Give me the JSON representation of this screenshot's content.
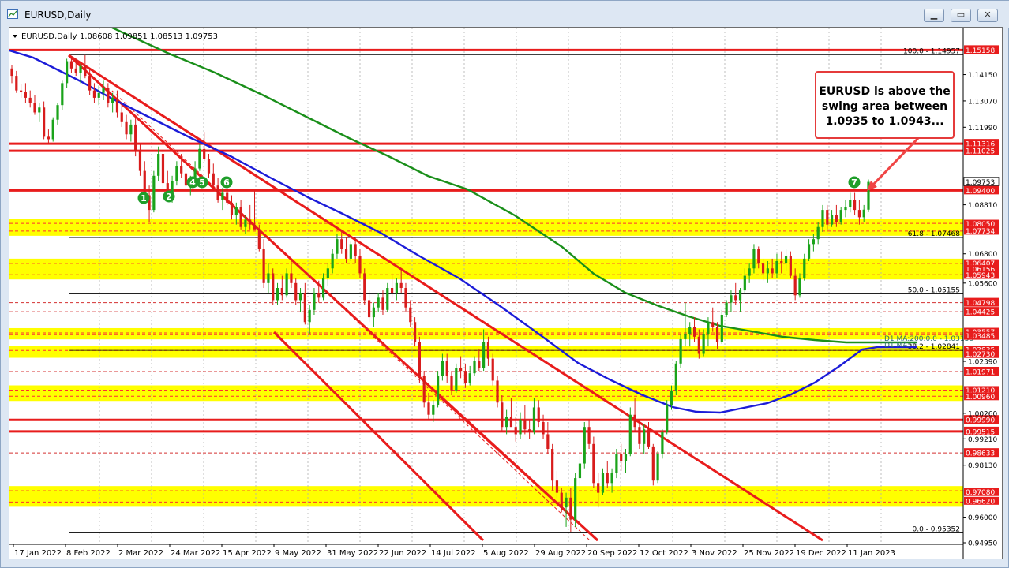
{
  "window": {
    "title": "EURUSD,Daily",
    "buttons": [
      "▁",
      "▭",
      "✕"
    ]
  },
  "colors": {
    "red": "#e81c1c",
    "yellow": "#ffff00",
    "blue": "#1c1cd8",
    "green": "#1a8f1a",
    "bull": "#1aa31a",
    "bear": "#d81c1c",
    "tag_green": "#1f9e2a"
  },
  "chart_data": {
    "type": "candlestick",
    "symbol_line": {
      "symbol": "EURUSD,Daily",
      "ohlc": "1.08608 1.09851 1.08513 1.09753"
    },
    "ylim": [
      0.9495,
      1.153
    ],
    "price_ticks": [
      1.1415,
      1.1307,
      1.1199,
      1.0881,
      1.068,
      1.056,
      1.0239,
      1.0026,
      0.9921,
      0.9813,
      0.96,
      0.9495
    ],
    "x_ticks": [
      "17 Jan 2022",
      "8 Feb 2022",
      "2 Mar 2022",
      "24 Mar 2022",
      "15 Apr 2022",
      "9 May 2022",
      "31 May 2022",
      "22 Jun 2022",
      "14 Jul 2022",
      "5 Aug 2022",
      "29 Aug 2022",
      "20 Sep 2022",
      "12 Oct 2022",
      "3 Nov 2022",
      "25 Nov 2022",
      "19 Dec 2022",
      "11 Jan 2023"
    ],
    "x_range_days": [
      0,
      370
    ],
    "current_price": "1.09753",
    "red_levels": [
      {
        "price": 1.15158,
        "label": "1.15158"
      },
      {
        "price": 1.11316,
        "label": "1.11316"
      },
      {
        "price": 1.11025,
        "label": "1.11025"
      },
      {
        "price": 1.094,
        "label": "1.09400"
      },
      {
        "price": 0.9999,
        "label": "0.99990"
      },
      {
        "price": 0.99515,
        "label": "0.99515"
      }
    ],
    "dashed_levels": [
      {
        "price": 1.04798,
        "label": "1.04798"
      },
      {
        "price": 1.04425,
        "label": "1.04425"
      },
      {
        "price": 1.01971,
        "label": "1.01971"
      },
      {
        "price": 0.98633,
        "label": "0.98633"
      }
    ],
    "yellow_zones": [
      {
        "top": 1.0805,
        "bottom": 1.07734,
        "labels": [
          "1.08050",
          "1.07734"
        ]
      },
      {
        "top": 1.06407,
        "bottom": 1.05943,
        "labels": [
          "1.06407",
          "1.06156",
          "1.05943"
        ]
      },
      {
        "top": 1.03557,
        "bottom": 1.03485,
        "labels": [
          "1.03557",
          "1.03485"
        ]
      },
      {
        "top": 1.02835,
        "bottom": 1.0273,
        "labels": [
          "1.02835",
          "1.02730"
        ]
      },
      {
        "top": 1.0121,
        "bottom": 1.0096,
        "labels": [
          "1.01210",
          "1.00960"
        ]
      },
      {
        "top": 0.9708,
        "bottom": 0.9662,
        "labels": [
          "0.97080",
          "0.96620"
        ]
      }
    ],
    "fibonacci": [
      {
        "price": 1.14957,
        "label": "100.0 - 1.14957"
      },
      {
        "price": 1.07468,
        "label": "61.8 - 1.07468"
      },
      {
        "price": 1.05155,
        "label": "50.0 - 1.05155"
      },
      {
        "price": 1.02841,
        "label": "38.2 - 1.02841"
      },
      {
        "price": 0.95352,
        "label": "0.0 - 0.95352"
      }
    ],
    "ma_labels": [
      "D1 MA:200:0.0 - 1.03138",
      "D1 MA:"
    ],
    "swing_markers": [
      "1",
      "2",
      "4",
      "5",
      "6",
      "7"
    ],
    "candles": [
      [
        1.144,
        1.1455,
        1.138,
        1.141
      ],
      [
        1.141,
        1.143,
        1.134,
        1.135
      ],
      [
        1.135,
        1.1375,
        1.132,
        1.1345
      ],
      [
        1.1345,
        1.138,
        1.13,
        1.132
      ],
      [
        1.132,
        1.135,
        1.128,
        1.13
      ],
      [
        1.13,
        1.133,
        1.125,
        1.126
      ],
      [
        1.126,
        1.13,
        1.122,
        1.128
      ],
      [
        1.128,
        1.1305,
        1.115,
        1.116
      ],
      [
        1.116,
        1.119,
        1.113,
        1.115
      ],
      [
        1.115,
        1.124,
        1.114,
        1.123
      ],
      [
        1.123,
        1.13,
        1.121,
        1.129
      ],
      [
        1.129,
        1.139,
        1.127,
        1.138
      ],
      [
        1.138,
        1.148,
        1.136,
        1.147
      ],
      [
        1.147,
        1.149,
        1.142,
        1.144
      ],
      [
        1.144,
        1.148,
        1.141,
        1.142
      ],
      [
        1.142,
        1.146,
        1.138,
        1.145
      ],
      [
        1.145,
        1.1495,
        1.14,
        1.141
      ],
      [
        1.141,
        1.144,
        1.133,
        1.135
      ],
      [
        1.135,
        1.138,
        1.13,
        1.132
      ],
      [
        1.132,
        1.137,
        1.129,
        1.134
      ],
      [
        1.134,
        1.139,
        1.131,
        1.136
      ],
      [
        1.136,
        1.138,
        1.128,
        1.13
      ],
      [
        1.13,
        1.134,
        1.126,
        1.132
      ],
      [
        1.132,
        1.135,
        1.124,
        1.126
      ],
      [
        1.126,
        1.13,
        1.12,
        1.122
      ],
      [
        1.122,
        1.125,
        1.115,
        1.117
      ],
      [
        1.117,
        1.123,
        1.114,
        1.121
      ],
      [
        1.121,
        1.124,
        1.108,
        1.11
      ],
      [
        1.11,
        1.113,
        1.1,
        1.102
      ],
      [
        1.102,
        1.106,
        1.09,
        1.092
      ],
      [
        1.092,
        1.096,
        1.081,
        1.086
      ],
      [
        1.086,
        1.102,
        1.085,
        1.1
      ],
      [
        1.1,
        1.112,
        1.098,
        1.109
      ],
      [
        1.109,
        1.11,
        1.095,
        1.097
      ],
      [
        1.097,
        1.102,
        1.09,
        1.091
      ],
      [
        1.091,
        1.1,
        1.089,
        1.098
      ],
      [
        1.098,
        1.106,
        1.096,
        1.104
      ],
      [
        1.104,
        1.109,
        1.099,
        1.101
      ],
      [
        1.101,
        1.104,
        1.094,
        1.096
      ],
      [
        1.096,
        1.1,
        1.092,
        1.098
      ],
      [
        1.098,
        1.106,
        1.097,
        1.103
      ],
      [
        1.103,
        1.113,
        1.102,
        1.111
      ],
      [
        1.111,
        1.118,
        1.106,
        1.107
      ],
      [
        1.107,
        1.109,
        1.099,
        1.101
      ],
      [
        1.101,
        1.105,
        1.094,
        1.096
      ],
      [
        1.096,
        1.099,
        1.089,
        1.09
      ],
      [
        1.09,
        1.095,
        1.086,
        1.093
      ],
      [
        1.093,
        1.096,
        1.088,
        1.089
      ],
      [
        1.089,
        1.092,
        1.082,
        1.084
      ],
      [
        1.084,
        1.089,
        1.08,
        1.087
      ],
      [
        1.087,
        1.09,
        1.078,
        1.079
      ],
      [
        1.079,
        1.084,
        1.076,
        1.082
      ],
      [
        1.082,
        1.088,
        1.078,
        1.08
      ],
      [
        1.08,
        1.094,
        1.079,
        1.078
      ],
      [
        1.078,
        1.08,
        1.069,
        1.07
      ],
      [
        1.07,
        1.074,
        1.054,
        1.056
      ],
      [
        1.056,
        1.064,
        1.052,
        1.06
      ],
      [
        1.06,
        1.062,
        1.047,
        1.049
      ],
      [
        1.049,
        1.056,
        1.047,
        1.054
      ],
      [
        1.054,
        1.059,
        1.049,
        1.051
      ],
      [
        1.051,
        1.062,
        1.05,
        1.06
      ],
      [
        1.06,
        1.065,
        1.054,
        1.056
      ],
      [
        1.056,
        1.058,
        1.047,
        1.049
      ],
      [
        1.049,
        1.054,
        1.044,
        1.052
      ],
      [
        1.052,
        1.056,
        1.039,
        1.04
      ],
      [
        1.04,
        1.047,
        1.035,
        1.045
      ],
      [
        1.045,
        1.054,
        1.043,
        1.052
      ],
      [
        1.052,
        1.057,
        1.048,
        1.05
      ],
      [
        1.05,
        1.06,
        1.049,
        1.058
      ],
      [
        1.058,
        1.064,
        1.055,
        1.062
      ],
      [
        1.062,
        1.07,
        1.06,
        1.068
      ],
      [
        1.068,
        1.076,
        1.066,
        1.074
      ],
      [
        1.074,
        1.077,
        1.068,
        1.07
      ],
      [
        1.07,
        1.075,
        1.064,
        1.066
      ],
      [
        1.066,
        1.073,
        1.065,
        1.072
      ],
      [
        1.072,
        1.075,
        1.064,
        1.067
      ],
      [
        1.067,
        1.07,
        1.058,
        1.06
      ],
      [
        1.06,
        1.062,
        1.047,
        1.049
      ],
      [
        1.049,
        1.053,
        1.04,
        1.042
      ],
      [
        1.042,
        1.048,
        1.038,
        1.046
      ],
      [
        1.046,
        1.052,
        1.044,
        1.05
      ],
      [
        1.05,
        1.053,
        1.043,
        1.045
      ],
      [
        1.045,
        1.056,
        1.044,
        1.054
      ],
      [
        1.054,
        1.06,
        1.05,
        1.052
      ],
      [
        1.052,
        1.058,
        1.049,
        1.056
      ],
      [
        1.056,
        1.061,
        1.052,
        1.054
      ],
      [
        1.054,
        1.056,
        1.044,
        1.046
      ],
      [
        1.046,
        1.049,
        1.038,
        1.04
      ],
      [
        1.04,
        1.042,
        1.03,
        1.032
      ],
      [
        1.032,
        1.034,
        1.015,
        1.018
      ],
      [
        1.018,
        1.02,
        1.005,
        1.007
      ],
      [
        1.007,
        1.011,
        1.0,
        1.002
      ],
      [
        1.002,
        1.008,
        0.999,
        1.006
      ],
      [
        1.006,
        1.02,
        1.005,
        1.018
      ],
      [
        1.018,
        1.027,
        1.016,
        1.024
      ],
      [
        1.024,
        1.027,
        1.015,
        1.018
      ],
      [
        1.018,
        1.02,
        1.01,
        1.012
      ],
      [
        1.012,
        1.023,
        1.011,
        1.021
      ],
      [
        1.021,
        1.026,
        1.017,
        1.02
      ],
      [
        1.02,
        1.023,
        1.013,
        1.015
      ],
      [
        1.015,
        1.022,
        1.014,
        1.019
      ],
      [
        1.019,
        1.026,
        1.018,
        1.024
      ],
      [
        1.024,
        1.029,
        1.02,
        1.021
      ],
      [
        1.021,
        1.037,
        1.02,
        1.032
      ],
      [
        1.032,
        1.034,
        1.022,
        1.025
      ],
      [
        1.025,
        1.027,
        1.014,
        1.016
      ],
      [
        1.016,
        1.018,
        1.005,
        1.007
      ],
      [
        1.007,
        1.01,
        0.995,
        0.997
      ],
      [
        0.997,
        1.004,
        0.994,
        1.001
      ],
      [
        1.001,
        1.009,
        0.999,
        0.997
      ],
      [
        0.997,
        1.001,
        0.991,
        0.994
      ],
      [
        0.994,
        1.003,
        0.992,
        1.0
      ],
      [
        1.0,
        1.006,
        0.994,
        0.996
      ],
      [
        0.996,
        1.0,
        0.992,
        0.995
      ],
      [
        0.995,
        1.009,
        0.994,
        1.005
      ],
      [
        1.005,
        1.008,
        0.997,
        0.999
      ],
      [
        0.999,
        1.002,
        0.992,
        0.994
      ],
      [
        0.994,
        0.999,
        0.986,
        0.988
      ],
      [
        0.988,
        0.99,
        0.971,
        0.975
      ],
      [
        0.975,
        0.979,
        0.968,
        0.97
      ],
      [
        0.97,
        0.972,
        0.962,
        0.964
      ],
      [
        0.964,
        0.97,
        0.956,
        0.968
      ],
      [
        0.968,
        0.972,
        0.954,
        0.959
      ],
      [
        0.959,
        0.978,
        0.956,
        0.976
      ],
      [
        0.976,
        0.985,
        0.973,
        0.982
      ],
      [
        0.982,
        0.999,
        0.98,
        0.997
      ],
      [
        0.997,
        1.0,
        0.988,
        0.99
      ],
      [
        0.99,
        0.993,
        0.972,
        0.974
      ],
      [
        0.974,
        0.978,
        0.964,
        0.97
      ],
      [
        0.97,
        0.98,
        0.969,
        0.978
      ],
      [
        0.978,
        0.983,
        0.972,
        0.974
      ],
      [
        0.974,
        0.98,
        0.97,
        0.978
      ],
      [
        0.978,
        0.988,
        0.976,
        0.986
      ],
      [
        0.986,
        0.99,
        0.979,
        0.983
      ],
      [
        0.983,
        0.988,
        0.978,
        0.986
      ],
      [
        0.986,
        1.005,
        0.985,
        1.002
      ],
      [
        1.002,
        1.009,
        0.995,
        0.997
      ],
      [
        0.997,
        0.999,
        0.988,
        0.99
      ],
      [
        0.99,
        0.998,
        0.986,
        0.996
      ],
      [
        0.996,
        0.999,
        0.988,
        0.989
      ],
      [
        0.989,
        0.99,
        0.973,
        0.975
      ],
      [
        0.975,
        0.987,
        0.974,
        0.986
      ],
      [
        0.986,
        0.996,
        0.984,
        0.995
      ],
      [
        0.995,
        1.008,
        0.994,
        1.006
      ],
      [
        1.006,
        1.014,
        1.004,
        1.012
      ],
      [
        1.012,
        1.024,
        1.01,
        1.023
      ],
      [
        1.023,
        1.035,
        1.021,
        1.033
      ],
      [
        1.033,
        1.048,
        1.03,
        1.035
      ],
      [
        1.035,
        1.04,
        1.03,
        1.038
      ],
      [
        1.038,
        1.042,
        1.032,
        1.034
      ],
      [
        1.034,
        1.037,
        1.025,
        1.027
      ],
      [
        1.027,
        1.037,
        1.026,
        1.035
      ],
      [
        1.035,
        1.042,
        1.03,
        1.04
      ],
      [
        1.04,
        1.046,
        1.036,
        1.038
      ],
      [
        1.038,
        1.04,
        1.029,
        1.032
      ],
      [
        1.032,
        1.045,
        1.031,
        1.043
      ],
      [
        1.043,
        1.049,
        1.042,
        1.048
      ],
      [
        1.048,
        1.053,
        1.044,
        1.051
      ],
      [
        1.051,
        1.056,
        1.047,
        1.049
      ],
      [
        1.049,
        1.054,
        1.044,
        1.053
      ],
      [
        1.053,
        1.062,
        1.052,
        1.059
      ],
      [
        1.059,
        1.064,
        1.056,
        1.062
      ],
      [
        1.062,
        1.072,
        1.06,
        1.07
      ],
      [
        1.07,
        1.071,
        1.062,
        1.064
      ],
      [
        1.064,
        1.066,
        1.057,
        1.06
      ],
      [
        1.06,
        1.065,
        1.056,
        1.062
      ],
      [
        1.062,
        1.066,
        1.058,
        1.06
      ],
      [
        1.06,
        1.068,
        1.058,
        1.065
      ],
      [
        1.065,
        1.069,
        1.06,
        1.064
      ],
      [
        1.064,
        1.07,
        1.061,
        1.067
      ],
      [
        1.067,
        1.069,
        1.058,
        1.059
      ],
      [
        1.059,
        1.062,
        1.049,
        1.051
      ],
      [
        1.051,
        1.06,
        1.05,
        1.058
      ],
      [
        1.058,
        1.068,
        1.057,
        1.066
      ],
      [
        1.066,
        1.074,
        1.065,
        1.072
      ],
      [
        1.072,
        1.076,
        1.069,
        1.074
      ],
      [
        1.074,
        1.081,
        1.072,
        1.079
      ],
      [
        1.079,
        1.088,
        1.077,
        1.086
      ],
      [
        1.086,
        1.088,
        1.078,
        1.08
      ],
      [
        1.08,
        1.086,
        1.079,
        1.084
      ],
      [
        1.084,
        1.088,
        1.079,
        1.081
      ],
      [
        1.081,
        1.087,
        1.08,
        1.086
      ],
      [
        1.086,
        1.09,
        1.083,
        1.087
      ],
      [
        1.087,
        1.093,
        1.085,
        1.09
      ],
      [
        1.09,
        1.093,
        1.084,
        1.086
      ],
      [
        1.086,
        1.09,
        1.08,
        1.083
      ],
      [
        1.083,
        1.088,
        1.081,
        1.0861
      ],
      [
        1.0861,
        1.0985,
        1.0851,
        1.0975
      ]
    ]
  },
  "callout": {
    "text": "EURUSD is above the swing area between 1.0935 to 1.0943..."
  }
}
